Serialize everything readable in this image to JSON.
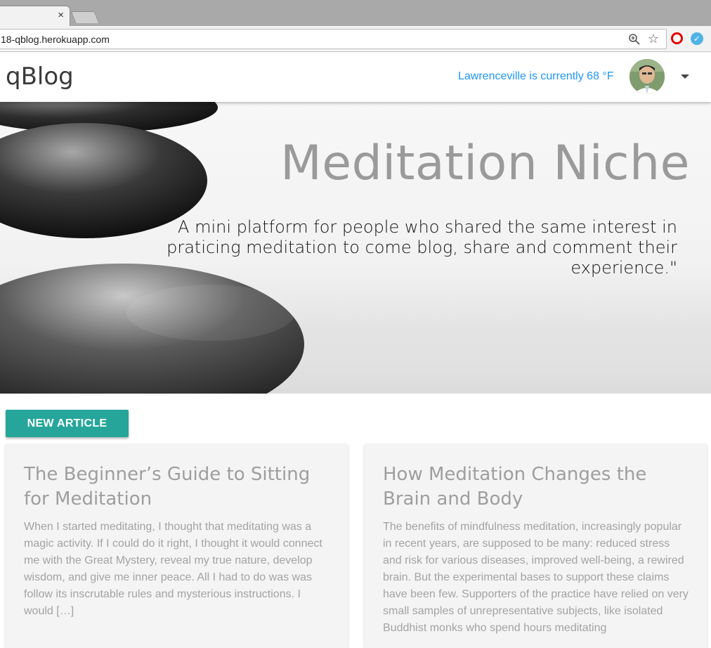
{
  "browser": {
    "url": "18-qblog.herokuapp.com",
    "tab_close": "×"
  },
  "app": {
    "brand": "qBlog",
    "weather": "Lawrenceville is currently 68 °F"
  },
  "hero": {
    "title": "Meditation Niche",
    "subtitle": "A mini platform for people who shared the same interest in praticing meditation to come blog, share and comment their experience.\""
  },
  "actions": {
    "new_article": "NEW ARTICLE"
  },
  "articles": [
    {
      "title": "The Beginner’s Guide to Sitting for Meditation",
      "excerpt": "When I started meditating, I thought that meditating was a magic activity. If I could do it right, I thought it would connect me with the Great Mystery, reveal my true nature, develop wisdom, and give me inner peace. All I had to do was was follow its inscrutable rules and mysterious instructions. I would […]"
    },
    {
      "title": "How Meditation Changes the Brain and Body",
      "excerpt": "The benefits of mindfulness meditation, increasingly popular in recent years, are supposed to be many: reduced stress and risk for various diseases, improved well-being, a rewired brain. But the experimental bases to support these claims have been few. Supporters of the practice have relied on very small samples of unrepresentative subjects, like isolated Buddhist monks who spend hours meditating"
    }
  ],
  "colors": {
    "accent": "#26a69a",
    "weather_text": "#2196f3"
  }
}
